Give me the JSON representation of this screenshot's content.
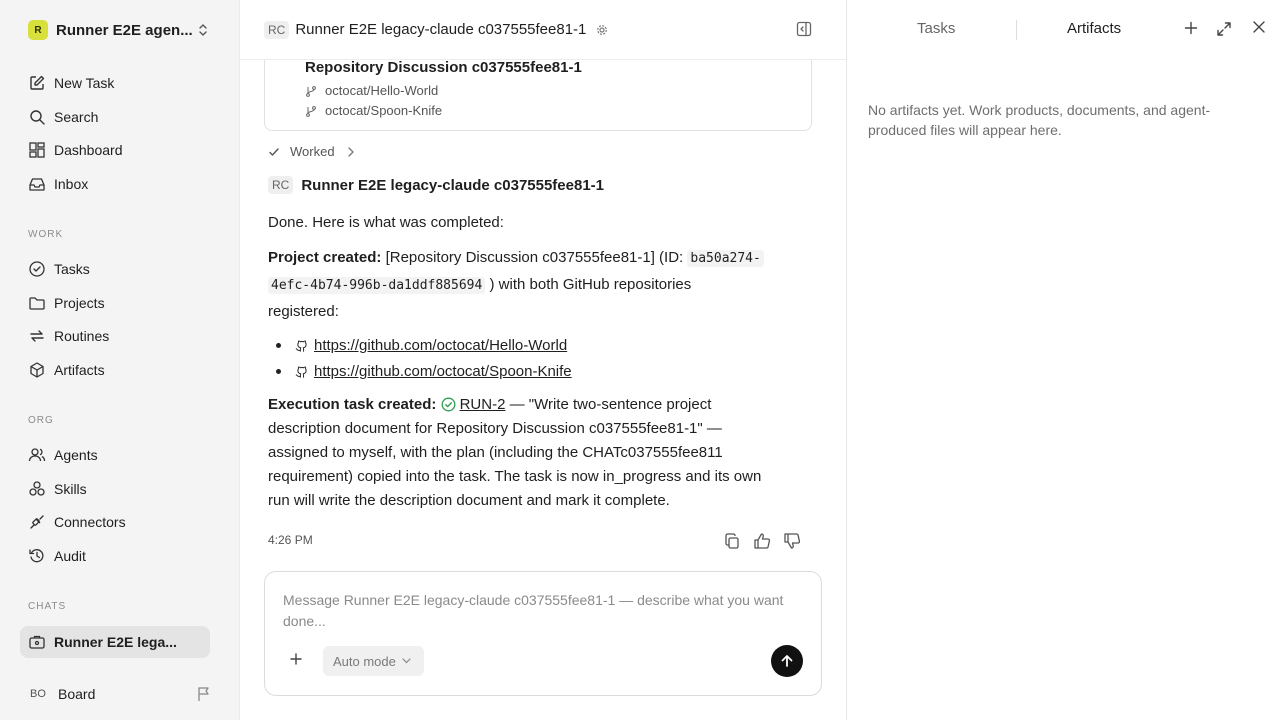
{
  "sidebar": {
    "workspace_initial": "R",
    "workspace_name": "Runner E2E agen...",
    "top_items": [
      {
        "label": "New Task",
        "icon": "new-task-icon"
      },
      {
        "label": "Search",
        "icon": "search-icon"
      },
      {
        "label": "Dashboard",
        "icon": "dashboard-icon"
      },
      {
        "label": "Inbox",
        "icon": "inbox-icon"
      }
    ],
    "work_label": "WORK",
    "work_items": [
      {
        "label": "Tasks",
        "icon": "tasks-icon"
      },
      {
        "label": "Projects",
        "icon": "folder-icon"
      },
      {
        "label": "Routines",
        "icon": "routines-icon"
      },
      {
        "label": "Artifacts",
        "icon": "artifacts-icon"
      }
    ],
    "org_label": "ORG",
    "org_items": [
      {
        "label": "Agents",
        "icon": "agents-icon"
      },
      {
        "label": "Skills",
        "icon": "skills-icon"
      },
      {
        "label": "Connectors",
        "icon": "connectors-icon"
      },
      {
        "label": "Audit",
        "icon": "audit-icon"
      }
    ],
    "chats_label": "CHATS",
    "chat_item": "Runner E2E lega...",
    "board_initials": "BO",
    "board_label": "Board"
  },
  "chat": {
    "header_initials": "RC",
    "header_title": "Runner E2E legacy-claude c037555fee81-1",
    "project_card": {
      "title": "Repository Discussion c037555fee81-1",
      "repos": [
        "octocat/Hello-World",
        "octocat/Spoon-Knife"
      ]
    },
    "worked_label": "Worked",
    "agent_initials": "RC",
    "agent_name": "Runner E2E legacy-claude c037555fee81-1",
    "intro": "Done. Here is what was completed:",
    "project_created_label": "Project created:",
    "project_created_text1": "[Repository Discussion c037555fee81-1] (ID:",
    "project_id_line1": "ba50a274-",
    "project_id_line2": "4efc-4b74-996b-da1ddf885694",
    "project_created_text2": ") with both GitHub repositories",
    "project_created_text3": "registered:",
    "links": [
      "https://github.com/octocat/Hello-World",
      "https://github.com/octocat/Spoon-Knife"
    ],
    "exec_label": "Execution task created:",
    "exec_run": "RUN-2",
    "exec_lines": [
      "— \"Write two-sentence project",
      "description document for Repository Discussion c037555fee81-1\" —",
      "assigned to myself, with the plan (including the CHATc037555fee811",
      "requirement) copied into the task. The task is now in_progress and its own",
      "run will write the description document and mark it complete."
    ],
    "timestamp": "4:26 PM",
    "composer_placeholder": "Message Runner E2E legacy-claude c037555fee81-1 — describe what you want done...",
    "mode_label": "Auto mode"
  },
  "right_panel": {
    "tab_tasks": "Tasks",
    "tab_artifacts": "Artifacts",
    "empty_text": "No artifacts yet. Work products, documents, and agent-produced files will appear here."
  }
}
